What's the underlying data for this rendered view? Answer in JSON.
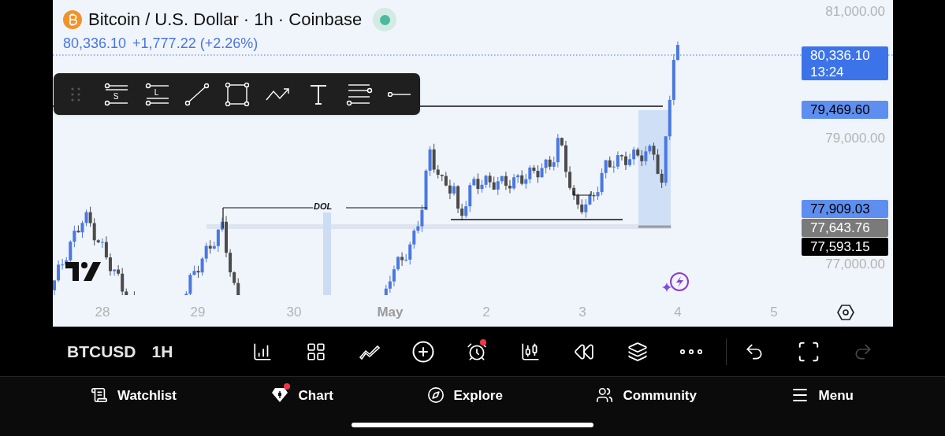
{
  "header": {
    "title": "Bitcoin / U.S. Dollar · 1h · Coinbase",
    "live": true,
    "price": "80,336.10",
    "change": "+1,777.22 (+2.26%)"
  },
  "drawing_toolbar": {
    "tools": [
      {
        "kind": "drag"
      },
      {
        "kind": "parallel",
        "letter": "S"
      },
      {
        "kind": "parallel-alt",
        "letter": "L"
      },
      {
        "kind": "trend"
      },
      {
        "kind": "rect"
      },
      {
        "kind": "path"
      },
      {
        "kind": "text"
      },
      {
        "kind": "fib"
      },
      {
        "kind": "ray"
      }
    ]
  },
  "chart": {
    "annotation": "DOL"
  },
  "price_axis": {
    "labels": [
      "81,000.00",
      "79,000.00",
      "77,000.00"
    ],
    "tags": [
      {
        "price": "80,336.10",
        "countdown": "13:24",
        "color": "#3d73e8"
      },
      {
        "price": "79,469.60",
        "color": "#5e8ff0"
      },
      {
        "price": "77,909.03",
        "color": "#5e8ff0"
      },
      {
        "price": "77,643.76",
        "color": "#7a7a7a"
      },
      {
        "price": "77,593.15",
        "color": "#000000"
      }
    ]
  },
  "time_axis": [
    {
      "label": "28",
      "emphasized": false
    },
    {
      "label": "29",
      "emphasized": false
    },
    {
      "label": "30",
      "emphasized": false
    },
    {
      "label": "May",
      "emphasized": true
    },
    {
      "label": "2",
      "emphasized": false
    },
    {
      "label": "3",
      "emphasized": false
    },
    {
      "label": "4",
      "emphasized": false
    },
    {
      "label": "5",
      "emphasized": false
    }
  ],
  "bottom_toolbar": {
    "symbol": "BTCUSD",
    "interval": "1H",
    "tools": [
      {
        "kind": "indicators",
        "badge": false,
        "disabled": false
      },
      {
        "kind": "grid",
        "badge": false,
        "disabled": false
      },
      {
        "kind": "patterns",
        "badge": false,
        "disabled": false
      },
      {
        "kind": "add",
        "badge": false,
        "disabled": false
      },
      {
        "kind": "alarm",
        "badge": true,
        "disabled": false
      },
      {
        "kind": "candles",
        "badge": false,
        "disabled": false
      },
      {
        "kind": "replay",
        "badge": false,
        "disabled": false
      },
      {
        "kind": "layers",
        "badge": false,
        "disabled": false
      },
      {
        "kind": "more",
        "badge": false,
        "disabled": false
      }
    ],
    "actions": [
      {
        "kind": "undo",
        "disabled": false
      },
      {
        "kind": "fullscreen",
        "disabled": false
      },
      {
        "kind": "redo",
        "disabled": true
      }
    ]
  },
  "nav": [
    {
      "label": "Watchlist",
      "kind": "watchlist",
      "badge": false
    },
    {
      "label": "Chart",
      "kind": "chart",
      "badge": true
    },
    {
      "label": "Explore",
      "kind": "explore",
      "badge": false
    },
    {
      "label": "Community",
      "kind": "community",
      "badge": false
    },
    {
      "label": "Menu",
      "kind": "menu",
      "badge": false
    }
  ]
}
